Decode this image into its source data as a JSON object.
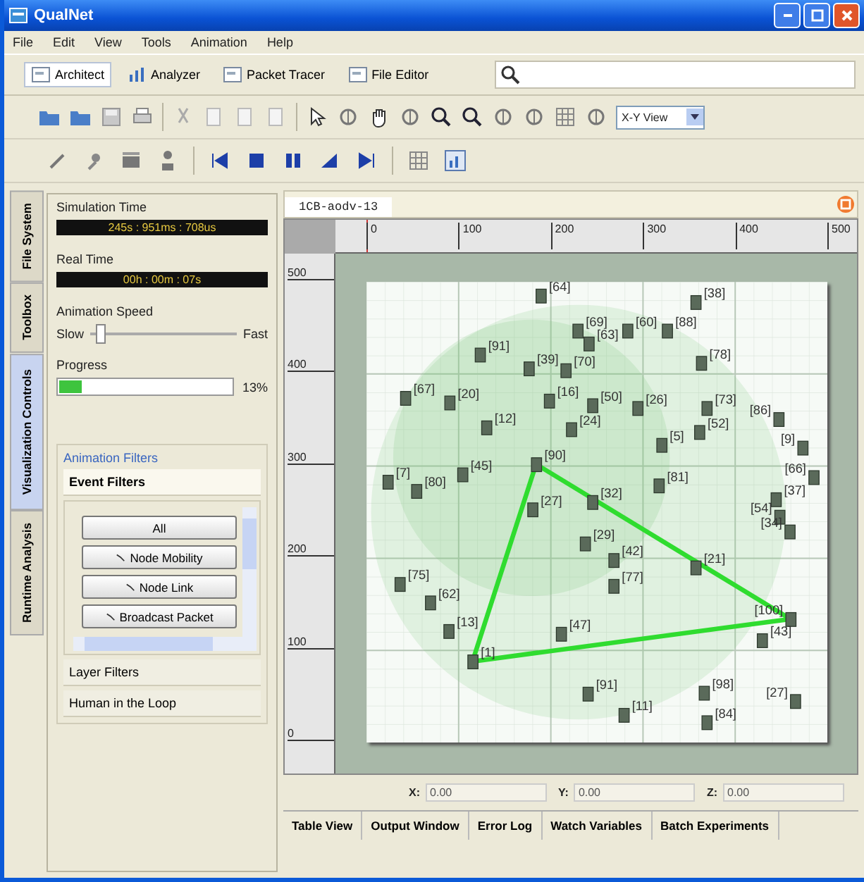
{
  "window": {
    "title": "QualNet"
  },
  "menu": [
    "File",
    "Edit",
    "View",
    "Tools",
    "Animation",
    "Help"
  ],
  "modes": [
    {
      "label": "Architect",
      "selected": true
    },
    {
      "label": "Analyzer",
      "selected": false
    },
    {
      "label": "Packet Tracer",
      "selected": false
    },
    {
      "label": "File Editor",
      "selected": false
    }
  ],
  "view_select": {
    "value": "X-Y View"
  },
  "side_tabs": [
    {
      "label": "File System",
      "selected": false
    },
    {
      "label": "Toolbox",
      "selected": false
    },
    {
      "label": "Visualization Controls",
      "selected": true
    },
    {
      "label": "Runtime Analysis",
      "selected": false
    }
  ],
  "simulation_time": {
    "label": "Simulation Time",
    "value": "245s : 951ms : 708us"
  },
  "real_time": {
    "label": "Real Time",
    "value": "00h : 00m : 07s"
  },
  "animation_speed": {
    "label": "Animation Speed",
    "min_label": "Slow",
    "max_label": "Fast",
    "level": 0.08
  },
  "progress": {
    "label": "Progress",
    "level": 0.13,
    "reading": "13%"
  },
  "animation_filters": {
    "title": "Animation Filters",
    "sections": [
      {
        "label": "Event Filters",
        "expanded": true
      },
      {
        "label": "Layer Filters",
        "expanded": false
      },
      {
        "label": "Human in the Loop",
        "expanded": false
      }
    ],
    "event_buttons": [
      {
        "label": "All",
        "kind": "all"
      },
      {
        "label": "Node Mobility",
        "kind": "filter"
      },
      {
        "label": "Node Link",
        "kind": "filter"
      },
      {
        "label": "Broadcast Packet",
        "kind": "filter"
      }
    ]
  },
  "document_tab": {
    "label": "1CB-aodv-13"
  },
  "ruler": {
    "x_ticks": [
      "0",
      "100",
      "200",
      "300",
      "400",
      "500"
    ],
    "y_ticks": [
      "500",
      "400",
      "300",
      "200",
      "100",
      "0"
    ]
  },
  "nodes": [
    {
      "label": "[64]"
    },
    {
      "label": "[38]"
    },
    {
      "label": "[69]"
    },
    {
      "label": "[63]"
    },
    {
      "label": "[60]"
    },
    {
      "label": "[88]"
    },
    {
      "label": "[91]"
    },
    {
      "label": "[39]"
    },
    {
      "label": "[70]"
    },
    {
      "label": "[78]"
    },
    {
      "label": "[67]"
    },
    {
      "label": "[20]"
    },
    {
      "label": "[16]"
    },
    {
      "label": "[50]"
    },
    {
      "label": "[26]"
    },
    {
      "label": "[73]"
    },
    {
      "label": "[12]"
    },
    {
      "label": "[24]"
    },
    {
      "label": "[52]"
    },
    {
      "label": "[5]"
    },
    {
      "label": "[86]"
    },
    {
      "label": "[9]"
    },
    {
      "label": "[90]"
    },
    {
      "label": "[45]"
    },
    {
      "label": "[7]"
    },
    {
      "label": "[80]"
    },
    {
      "label": "[27]"
    },
    {
      "label": "[32]"
    },
    {
      "label": "[81]"
    },
    {
      "label": "[37]"
    },
    {
      "label": "[54]"
    },
    {
      "label": "[66]"
    },
    {
      "label": "[29]"
    },
    {
      "label": "[42]"
    },
    {
      "label": "[34]"
    },
    {
      "label": "[21]"
    },
    {
      "label": "[75]"
    },
    {
      "label": "[62]"
    },
    {
      "label": "[77]"
    },
    {
      "label": "[13]"
    },
    {
      "label": "[47]"
    },
    {
      "label": "[100]"
    },
    {
      "label": "[43]"
    },
    {
      "label": "[1]"
    },
    {
      "label": "[91]"
    },
    {
      "label": "[11]"
    },
    {
      "label": "[98]"
    },
    {
      "label": "[84]"
    },
    {
      "label": "[27]"
    }
  ],
  "coordinates": [
    {
      "label": "X:",
      "value": "0.00"
    },
    {
      "label": "Y:",
      "value": "0.00"
    },
    {
      "label": "Z:",
      "value": "0.00"
    }
  ],
  "bottom_tabs": [
    "Table View",
    "Output Window",
    "Error Log",
    "Watch Variables",
    "Batch Experiments"
  ]
}
